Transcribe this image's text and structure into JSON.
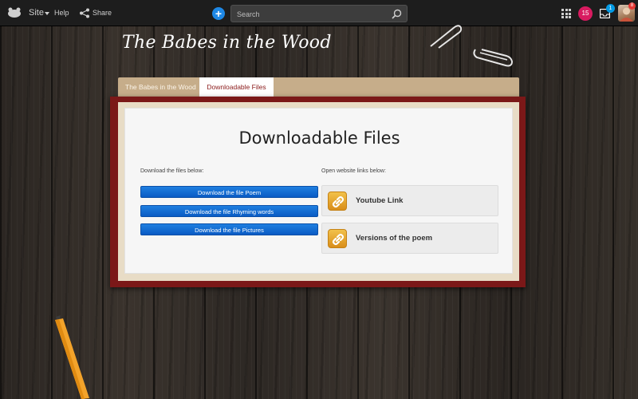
{
  "topbar": {
    "site_label": "Site",
    "help_label": "Help",
    "share_label": "Share",
    "search_placeholder": "Search",
    "notifications_count": "15",
    "inbox_count": "1",
    "avatar_badge_count": "8"
  },
  "page": {
    "title": "The Babes in the Wood"
  },
  "tabs": [
    {
      "label": "The Babes in the Wood"
    },
    {
      "label": "Downloadable Files"
    }
  ],
  "main": {
    "heading": "Downloadable Files",
    "download_label": "Download the files below:",
    "links_label": "Open website links below:",
    "downloads": [
      {
        "label": "Download the file Poem"
      },
      {
        "label": "Download the file Rhyming words"
      },
      {
        "label": "Download the file Pictures"
      }
    ],
    "links": [
      {
        "label": "Youtube Link",
        "icon": "link-icon"
      },
      {
        "label": "Versions of the poem",
        "icon": "link-icon"
      }
    ]
  },
  "colors": {
    "accent_blue": "#1e88e5",
    "frame_red": "#7b1818",
    "tab_tan": "#c6ad8a",
    "notification_pink": "#d81b60"
  }
}
